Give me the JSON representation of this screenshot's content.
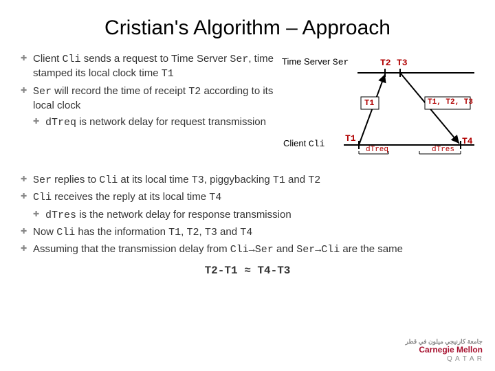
{
  "title": "Cristian's Algorithm – Approach",
  "left_bullets": {
    "b1_pre": "Client ",
    "b1_cli": "Cli",
    "b1_mid": " sends a request to Time Server ",
    "b1_ser": "Ser",
    "b1_post1": ", time stamped its local clock time ",
    "b1_t1": "T1",
    "b2_pre": "",
    "b2_ser": "Ser",
    "b2_mid": " will record the time of receipt ",
    "b2_t2": "T2",
    "b2_post": " according to its local clock",
    "b2a_pre": "",
    "b2a_dtreq": "dTreq",
    "b2a_post": " is network delay for request transmission"
  },
  "bottom_bullets": {
    "b3_ser": "Ser",
    "b3_mid1": " replies to ",
    "b3_cli": "Cli",
    "b3_mid2": " at its local time ",
    "b3_t3": "T3",
    "b3_mid3": ", piggybacking ",
    "b3_t1": "T1",
    "b3_and": " and ",
    "b3_t2": "T2",
    "b4_cli": "Cli",
    "b4_mid": " receives the reply at its local time ",
    "b4_t4": "T4",
    "b4a_dtres": "dTres",
    "b4a_post": " is the network delay for response transmission",
    "b5_pre": "Now ",
    "b5_cli": "Cli",
    "b5_mid": " has the information ",
    "b5_t1": "T1",
    "b5_c1": ", ",
    "b5_t2": "T2",
    "b5_c2": ", ",
    "b5_t3": "T3",
    "b5_and": " and ",
    "b5_t4": "T4",
    "b6_pre": "Assuming that the transmission delay from ",
    "b6_cliser": "Cli→Ser",
    "b6_and": " and ",
    "b6_sercli": "Ser→Cli",
    "b6_post": " are the same"
  },
  "equation": "T2-T1 ≈ T4-T3",
  "diagram": {
    "timeserver_label": "Time Server ",
    "timeserver_ser": "Ser",
    "client_label": "Client ",
    "client_cli": "Cli",
    "t1_box": "T1",
    "t1t2t3_box": "T1, T2, T3",
    "t2": "T2",
    "t3": "T3",
    "t1_bottom": "T1",
    "t4_bottom": "T4",
    "dtreq": "dTreq",
    "dtres": "dTres"
  },
  "logo": {
    "arabic": "جامعة كارنيجي ميلون في قطر",
    "main": "Carnegie Mellon",
    "qatar": "Q A T A R"
  },
  "chart_data": {
    "type": "diagram",
    "description": "Cristian's algorithm message exchange timeline",
    "entities": [
      "Time Server Ser",
      "Client Cli"
    ],
    "events": [
      {
        "at": "Client",
        "time": "T1",
        "action": "send request"
      },
      {
        "at": "Server",
        "time": "T2",
        "action": "receive request"
      },
      {
        "at": "Server",
        "time": "T3",
        "action": "send reply piggybacking T1,T2"
      },
      {
        "at": "Client",
        "time": "T4",
        "action": "receive reply"
      }
    ],
    "delays": {
      "request": "dTreq",
      "response": "dTres"
    },
    "relation": "T2-T1 ≈ T4-T3"
  }
}
